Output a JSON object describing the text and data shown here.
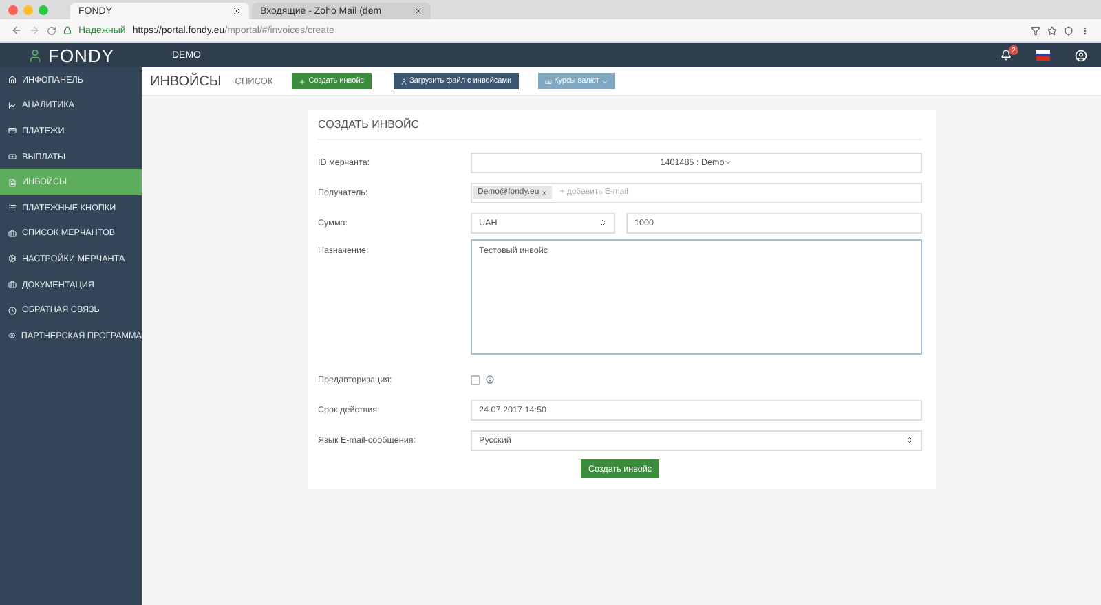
{
  "browser": {
    "tabs": [
      {
        "title": "FONDY",
        "selected": true
      },
      {
        "title": "Входящие - Zoho Mail (dem",
        "selected": false
      }
    ],
    "secure_label": "Надежный",
    "url_host": "https://portal.fondy.eu",
    "url_path": "/mportal/#/invoices/create"
  },
  "header": {
    "logo": "FONDY",
    "merchant": "DEMO",
    "notifications": "2"
  },
  "sidebar": {
    "items": [
      {
        "label": "ИНФОПАНЕЛЬ",
        "selected": false
      },
      {
        "label": "АНАЛИТИКА",
        "selected": false
      },
      {
        "label": "ПЛАТЕЖИ",
        "selected": false
      },
      {
        "label": "ВЫПЛАТЫ",
        "selected": false
      },
      {
        "label": "ИНВОЙСЫ",
        "selected": true
      },
      {
        "label": "ПЛАТЕЖНЫЕ КНОПКИ",
        "selected": false
      },
      {
        "label": "СПИСОК МЕРЧАНТОВ",
        "selected": false
      },
      {
        "label": "НАСТРОЙКИ МЕРЧАНТА",
        "selected": false
      },
      {
        "label": "ДОКУМЕНТАЦИЯ",
        "selected": false
      },
      {
        "label": "ОБРАТНАЯ СВЯЗЬ",
        "selected": false
      },
      {
        "label": "ПАРТНЕРСКАЯ ПРОГРАММА",
        "selected": false
      }
    ]
  },
  "toolbar": {
    "title": "ИНВОЙСЫ",
    "link": "СПИСОК",
    "buttons": [
      {
        "label": "Создать инвойс",
        "kind": "create"
      },
      {
        "label": "Загрузить файл с инвойсами",
        "kind": "upload"
      },
      {
        "label": "Курсы валют",
        "kind": "rates"
      }
    ]
  },
  "form": {
    "title": "СОЗДАТЬ ИНВОЙС",
    "merchant": {
      "label": "ID мерчанта:",
      "value": "1401485 : Demo"
    },
    "recipient": {
      "label": "Получатель:",
      "tag": "Demo@fondy.eu",
      "placeholder": "+ добавить E-mail"
    },
    "amount": {
      "label": "Сумма:",
      "currency": "UAH",
      "value": "1000"
    },
    "purpose": {
      "label": "Назначение:",
      "value": "Тестовый инвойс"
    },
    "preauth": {
      "label": "Предавторизация:",
      "checked": false
    },
    "expiry": {
      "label": "Срок действия:",
      "value": "24.07.2017 14:50"
    },
    "language": {
      "label": "Язык E-mail-сообщения:",
      "value": "Русский"
    },
    "submit": "Создать инвойс"
  }
}
